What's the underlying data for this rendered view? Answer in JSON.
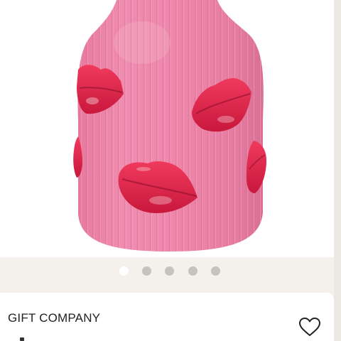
{
  "product": {
    "brand": "GIFT COMPANY",
    "image_icon": "vase-with-lips-product-photo"
  },
  "gallery": {
    "dot_count": 5,
    "active_index": 0
  },
  "actions": {
    "favorite_icon": "heart-outline-icon"
  },
  "colors": {
    "vase_pink": "#ee86aa",
    "lips_red": "#dd1f45",
    "background": "#f4f1ec",
    "dot_inactive": "#c6c2bc",
    "dot_active": "#ffffff"
  }
}
